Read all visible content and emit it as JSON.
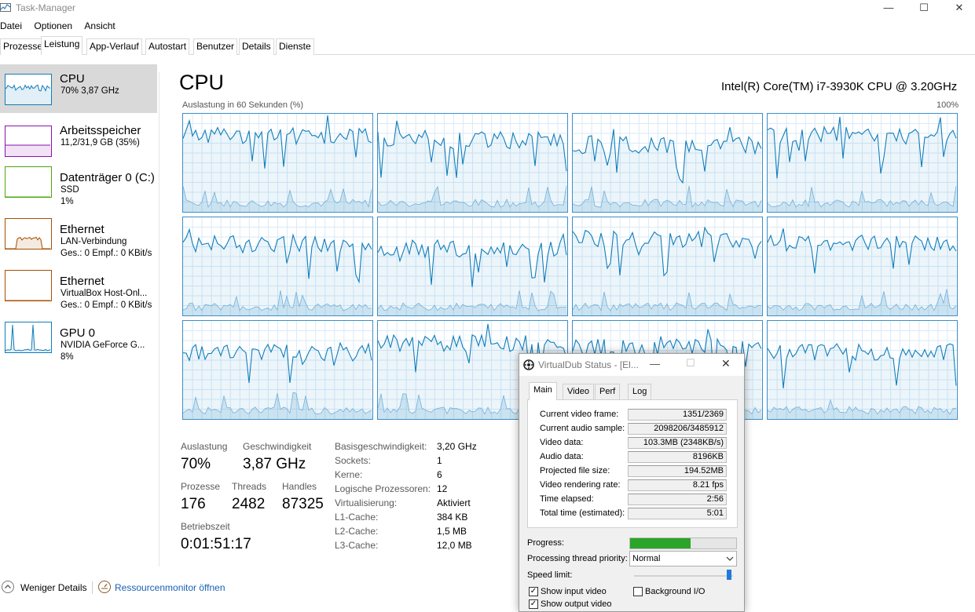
{
  "window": {
    "title": "Task-Manager",
    "minimize": "—",
    "maximize": "☐",
    "close": "✕"
  },
  "menu": [
    "Datei",
    "Optionen",
    "Ansicht"
  ],
  "tabs": [
    "Prozesse",
    "Leistung",
    "App-Verlauf",
    "Autostart",
    "Benutzer",
    "Details",
    "Dienste"
  ],
  "active_tab": "Leistung",
  "sidebar": [
    {
      "title": "CPU",
      "sub1": "70% 3,87 GHz",
      "sub2": "",
      "color": "#117dbb",
      "selected": true
    },
    {
      "title": "Arbeitsspeicher",
      "sub1": "11,2/31,9 GB (35%)",
      "sub2": "",
      "color": "#8b12ae",
      "selected": false
    },
    {
      "title": "Datenträger 0 (C:)",
      "sub1": "SSD",
      "sub2": "1%",
      "color": "#4da60c",
      "selected": false
    },
    {
      "title": "Ethernet",
      "sub1": "LAN-Verbindung",
      "sub2": "Ges.: 0 Empf.: 0 KBit/s",
      "color": "#a74f01",
      "selected": false
    },
    {
      "title": "Ethernet",
      "sub1": "VirtualBox Host-Onl...",
      "sub2": "Ges.: 0 Empf.: 0 KBit/s",
      "color": "#a74f01",
      "selected": false
    },
    {
      "title": "GPU 0",
      "sub1": "NVIDIA GeForce G...",
      "sub2": "8%",
      "color": "#117dbb",
      "selected": false
    }
  ],
  "main": {
    "heading": "CPU",
    "model": "Intel(R) Core(TM) i7-3930K CPU @ 3.20GHz",
    "graph_label": "Auslastung in 60 Sekunden (%)",
    "graph_max": "100%",
    "core_count": 12
  },
  "stats": {
    "auslastung_label": "Auslastung",
    "auslastung": "70%",
    "geschw_label": "Geschwindigkeit",
    "geschw": "3,87 GHz",
    "prozesse_label": "Prozesse",
    "prozesse": "176",
    "threads_label": "Threads",
    "threads": "2482",
    "handles_label": "Handles",
    "handles": "87325",
    "betrieb_label": "Betriebszeit",
    "betrieb": "0:01:51:17"
  },
  "details": [
    {
      "k": "Basisgeschwindigkeit:",
      "v": "3,20 GHz"
    },
    {
      "k": "Sockets:",
      "v": "1"
    },
    {
      "k": "Kerne:",
      "v": "6"
    },
    {
      "k": "Logische Prozessoren:",
      "v": "12"
    },
    {
      "k": "Virtualisierung:",
      "v": "Aktiviert"
    },
    {
      "k": "L1-Cache:",
      "v": "384 KB"
    },
    {
      "k": "L2-Cache:",
      "v": "1,5 MB"
    },
    {
      "k": "L3-Cache:",
      "v": "12,0 MB"
    }
  ],
  "footer": {
    "less": "Weniger Details",
    "resmon": "Ressourcenmonitor öffnen"
  },
  "colors": {
    "accent": "#117dbb",
    "graph_border": "#3d8ec9",
    "grid": "#d9eaf7",
    "progress": "#2aa52a"
  },
  "vdub": {
    "title": "VirtualDub Status - [El...",
    "tabs": [
      "Main",
      "Video",
      "Perf",
      "Log"
    ],
    "fields": [
      {
        "k": "Current video frame:",
        "v": "1351/2369"
      },
      {
        "k": "Current audio sample:",
        "v": "2098206/3485912"
      },
      {
        "k": "Video data:",
        "v": "103.3MB (2348KB/s)"
      },
      {
        "k": "Audio data:",
        "v": "8196KB"
      },
      {
        "k": "Projected file size:",
        "v": "194.52MB"
      },
      {
        "k": "Video rendering rate:",
        "v": "8.21 fps"
      },
      {
        "k": "Time elapsed:",
        "v": "2:56"
      },
      {
        "k": "Total time (estimated):",
        "v": "5:01"
      }
    ],
    "progress_label": "Progress:",
    "progress": 0.57,
    "priority_label": "Processing thread priority:",
    "priority": "Normal",
    "speed_label": "Speed limit:",
    "show_input": "Show input video",
    "show_output": "Show output video",
    "background": "Background I/O"
  }
}
